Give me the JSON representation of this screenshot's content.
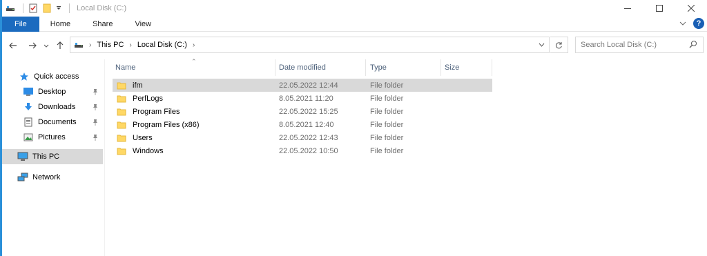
{
  "window": {
    "title": "Local Disk (C:)",
    "accent": "#2b90d9"
  },
  "ribbon": {
    "tabs": [
      "File",
      "Home",
      "Share",
      "View"
    ],
    "file_color": "#1b6bbf"
  },
  "address": {
    "crumbs": [
      "This PC",
      "Local Disk (C:)"
    ],
    "search_placeholder": "Search Local Disk (C:)"
  },
  "nav": {
    "quick_access": "Quick access",
    "pinned": [
      {
        "label": "Desktop",
        "icon": "desktop-icon"
      },
      {
        "label": "Downloads",
        "icon": "downloads-icon"
      },
      {
        "label": "Documents",
        "icon": "documents-icon"
      },
      {
        "label": "Pictures",
        "icon": "pictures-icon"
      }
    ],
    "this_pc": "This PC",
    "network": "Network"
  },
  "columns": {
    "name": "Name",
    "date": "Date modified",
    "type": "Type",
    "size": "Size"
  },
  "files": [
    {
      "name": "ifm",
      "date": "22.05.2022 12:44",
      "type": "File folder",
      "selected": true
    },
    {
      "name": "PerfLogs",
      "date": "8.05.2021 11:20",
      "type": "File folder"
    },
    {
      "name": "Program Files",
      "date": "22.05.2022 15:25",
      "type": "File folder"
    },
    {
      "name": "Program Files (x86)",
      "date": "8.05.2021 12:40",
      "type": "File folder"
    },
    {
      "name": "Users",
      "date": "22.05.2022 12:43",
      "type": "File folder"
    },
    {
      "name": "Windows",
      "date": "22.05.2022 10:50",
      "type": "File folder"
    }
  ]
}
